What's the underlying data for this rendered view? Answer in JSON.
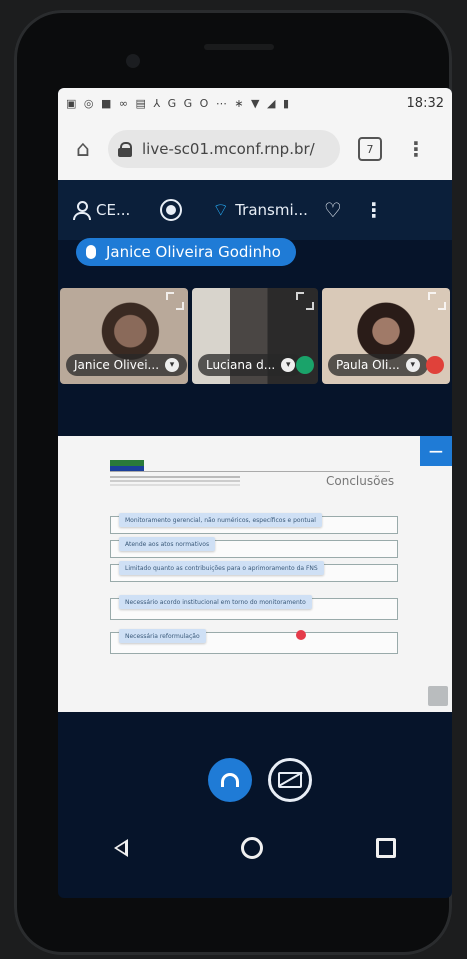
{
  "status_bar": {
    "icons": "▣ ◎ ■ ∞ ▤ ⅄ G G O ⋯ ∗ ▼ ◢ ▮",
    "time": "18:32"
  },
  "browser": {
    "url": "live-sc01.mconf.rnp.br/",
    "tab_count": "7"
  },
  "meeting": {
    "user_label": "CE...",
    "connection_label": "Transmi...",
    "talking": "Janice Oliveira Godinho"
  },
  "participants": [
    {
      "name": "Janice Olivei..."
    },
    {
      "name": "Luciana d..."
    },
    {
      "name": "Paula Oli..."
    }
  ],
  "presentation": {
    "slide_title": "Conclusões",
    "bullets": [
      {
        "text": "Monitoramento gerencial, não numéricos, específicos e pontual",
        "sub": ""
      },
      {
        "text": "Atende aos atos normativos",
        "sub": ""
      },
      {
        "text": "Limitado quanto as contribuições para o aprimoramento da FNS",
        "sub": ""
      },
      {
        "text": "Necessário acordo institucional em torno do monitoramento",
        "sub": ""
      },
      {
        "text": "Necessária reformulação",
        "sub": ""
      }
    ]
  },
  "colors": {
    "accent": "#1f7bd6",
    "background": "#06142a",
    "pointer": "#e53b4a",
    "status_ok": "#1aa36a",
    "status_muted": "#e0413a"
  }
}
